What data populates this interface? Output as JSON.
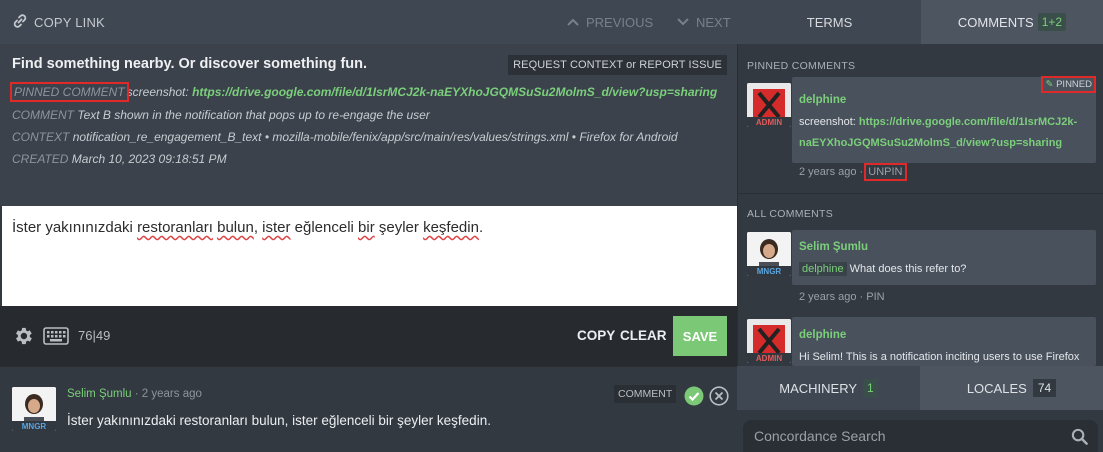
{
  "topbar": {
    "copy_link": "COPY LINK",
    "previous": "PREVIOUS",
    "next": "NEXT",
    "terms_tab": "TERMS",
    "comments_tab": "COMMENTS",
    "comments_count": "1+2"
  },
  "source": {
    "title": "Find something nearby. Or discover something fun.",
    "request_button": "REQUEST CONTEXT or REPORT ISSUE",
    "pinned_label": "PINNED COMMENT",
    "pinned_prefix": "screenshot:",
    "pinned_link": "https://drive.google.com/file/d/1IsrMCJ2k-naEYXhoJGQMSuSu2MolmS_d/view?usp=sharing",
    "comment_label": "COMMENT",
    "comment_value": "Text B shown in the notification that pops up to re-engage the user",
    "context_label": "CONTEXT",
    "context_value": "notification_re_engagement_B_text • mozilla-mobile/fenix/app/src/main/res/values/strings.xml • Firefox for Android",
    "created_label": "CREATED",
    "created_value": "March 10, 2023 09:18:51 PM"
  },
  "editor": {
    "w1": "İster yakınınızdaki ",
    "w2": "restoranları",
    "w3": " ",
    "w4": "bulun",
    "w5": ", ",
    "w6": "ister",
    "w7": " eğlenceli ",
    "w8": "bir",
    "w9": " şeyler ",
    "w10": "keşfedin",
    "w11": "."
  },
  "toolbar": {
    "count": "76|49",
    "copy": "COPY",
    "clear": "CLEAR",
    "save": "SAVE"
  },
  "history": {
    "author": "Selim Şumlu",
    "time": " · 2 years ago",
    "text": "İster yakınınızdaki restoranları bulun, ister eğlenceli bir şeyler keşfedin.",
    "comment_button": "COMMENT",
    "role": "MNGR"
  },
  "comments": {
    "pinned_heading": "PINNED COMMENTS",
    "pinned_badge": "PINNED",
    "pinned": {
      "author": "delphine",
      "role": "ADMIN",
      "text_prefix": "screenshot: ",
      "link_line1": "https://drive.google.com/file/d/1IsrMCJ2k-",
      "link_line2": "naEYXhoJGQMSuSu2MolmS_d/view?usp=sharing",
      "time": "2 years ago",
      "dot": " · ",
      "action": "UNPIN"
    },
    "all_heading": "ALL COMMENTS",
    "items": [
      {
        "author": "Selim Şumlu",
        "role": "MNGR",
        "mention": "delphine",
        "text": " What does this refer to?",
        "time": "2 years ago",
        "action": " · PIN"
      },
      {
        "author": "delphine",
        "role": "ADMIN",
        "text": "Hi Selim! This is a notification inciting users to use Firefox"
      }
    ]
  },
  "bottom_tabs": {
    "machinery": "MACHINERY",
    "machinery_count": "1",
    "locales": "LOCALES",
    "locales_count": "74"
  },
  "search": {
    "placeholder": "Concordance Search"
  },
  "colors": {
    "accent_green": "#7bcf7b",
    "save_green": "#7bc876",
    "highlight_red": "#e02a2a"
  }
}
